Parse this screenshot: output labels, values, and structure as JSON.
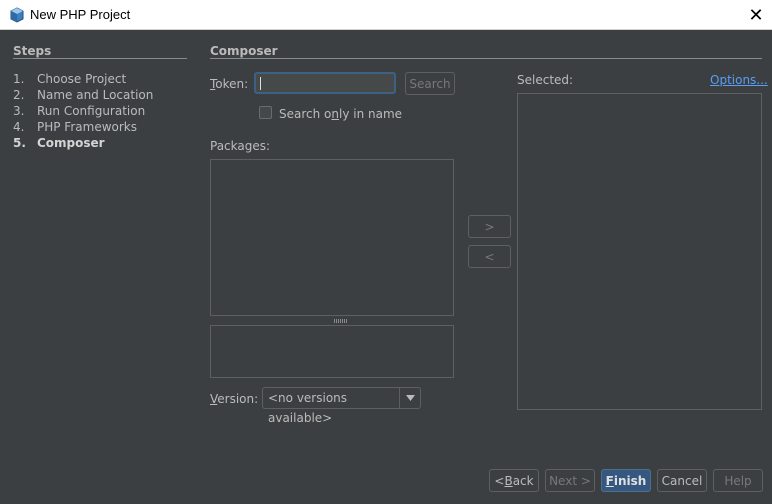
{
  "window": {
    "title": "New PHP Project",
    "close_glyph": "✕"
  },
  "steps": {
    "heading": "Steps",
    "items": [
      {
        "num": "1.",
        "label": "Choose Project"
      },
      {
        "num": "2.",
        "label": "Name and Location"
      },
      {
        "num": "3.",
        "label": "Run Configuration"
      },
      {
        "num": "4.",
        "label": "PHP Frameworks"
      },
      {
        "num": "5.",
        "label": "Composer"
      }
    ],
    "current_index": 4
  },
  "composer": {
    "heading": "Composer",
    "token_label_mnemonic": "T",
    "token_label_rest": "oken:",
    "token_value": "",
    "search_button": "Search",
    "search_only_label_pre": "Search o",
    "search_only_label_mnemonic": "n",
    "search_only_label_post": "ly in name",
    "search_only_checked": false,
    "packages_label": "Packages:",
    "selected_label": "Selected:",
    "options_link": "Options...",
    "add_button": ">",
    "remove_button": "<",
    "version_label_mnemonic": "V",
    "version_label_rest": "ersion:",
    "version_value": "<no versions available>"
  },
  "footer": {
    "back_pre": "< ",
    "back_mnemonic": "B",
    "back_post": "ack",
    "next": "Next >",
    "finish_mnemonic": "F",
    "finish_rest": "inish",
    "cancel": "Cancel",
    "help": "Help"
  },
  "colors": {
    "background": "#3c3f41",
    "accent": "#365880",
    "link": "#589df6"
  }
}
